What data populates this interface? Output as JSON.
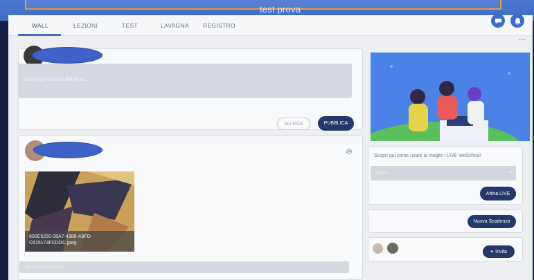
{
  "app": {
    "title": "test prova"
  },
  "tabs": [
    "WALL",
    "LEZIONI",
    "TEST",
    "LAVAGNA",
    "REGISTRO"
  ],
  "composer": {
    "placeholder": "Scrivi qui il testo del post...",
    "attach_label": "ALLEGA",
    "publish_label": "PUBBLICA"
  },
  "post": {
    "image_caption": "600E5250-35A7-4388-A9FD-C615173FCDDC.jpeg",
    "comment_placeholder": "Scrivi un commento"
  },
  "sidebar": {
    "live_text": "Scopri qui come usare al meglio i LIVE WeSchool",
    "select_value": "Zoom",
    "live_button": "Attiva LIVE",
    "deadline_button": "Nuova Scadenza",
    "invite_button": "Invita"
  },
  "colors": {
    "primary": "#3f6cc4",
    "dark_button": "#23386b",
    "redaction": "#3f62c9"
  }
}
